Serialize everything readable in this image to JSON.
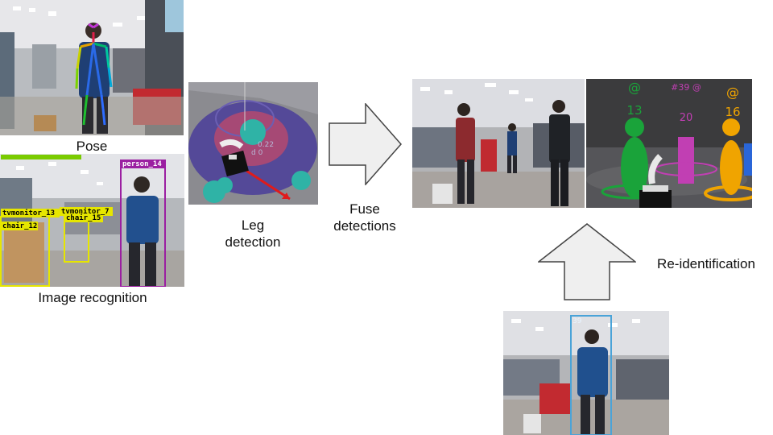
{
  "captions": {
    "pose": "Pose",
    "image_recognition": "Image recognition",
    "leg_detection_line1": "Leg",
    "leg_detection_line2": "detection",
    "fuse_line1": "Fuse",
    "fuse_line2": "detections",
    "reid": "Re-identification"
  },
  "detection_labels": {
    "person": "person_14",
    "tvmonitor_a": "tvmonitor_13",
    "tvmonitor_b": "tvmonitor_7",
    "chair_a": "chair_15",
    "chair_b": "chair_12"
  },
  "leg_overlay": {
    "text_a": "0.22",
    "text_b": "d 0"
  },
  "rviz_markers": [
    {
      "label": "@",
      "id": "13",
      "color": "#1aa33a"
    },
    {
      "label": "#39 @",
      "id": "20",
      "color": "#c13fb3"
    },
    {
      "label": "@",
      "id": "16",
      "color": "#f0a400"
    }
  ],
  "reid_box_id": "39",
  "colors": {
    "arrow_fill": "#efefef",
    "arrow_stroke": "#444444",
    "yolo_yellow": "#e6e600",
    "yolo_purple": "#9b1fa1",
    "reid_box": "#4aa3d8"
  }
}
